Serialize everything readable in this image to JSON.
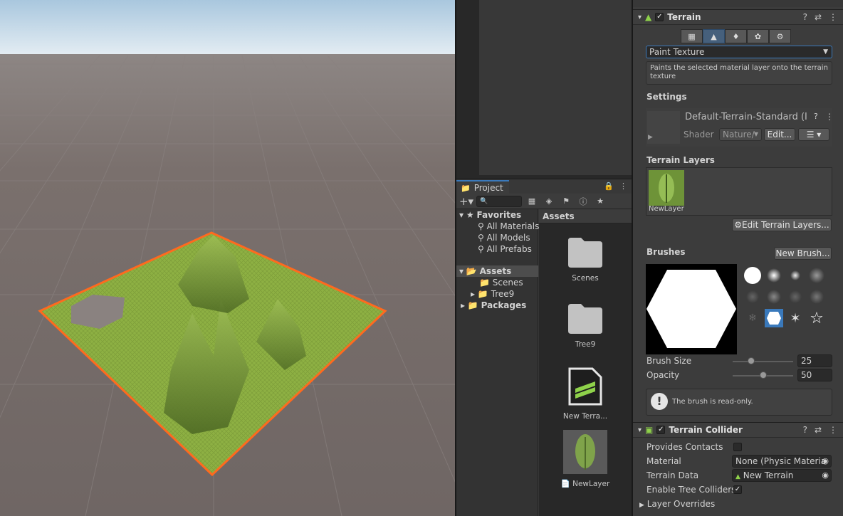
{
  "colors": {
    "sky_top": "#a9c7de",
    "sky_horizon": "#e4edf3",
    "ground": "#766d6a",
    "terrain_green": "#8db043",
    "selection_outline": "#ff6a1e",
    "accent_blue": "#3a79bb"
  },
  "project": {
    "tab_label": "Project",
    "search_placeholder": "",
    "tree": {
      "favorites": "Favorites",
      "all_materials": "All Materials",
      "all_models": "All Models",
      "all_prefabs": "All Prefabs",
      "assets": "Assets",
      "scenes": "Scenes",
      "tree9": "Tree9",
      "packages": "Packages"
    },
    "assets_header": "Assets",
    "items": [
      {
        "label": "Scenes",
        "icon": "folder-icon"
      },
      {
        "label": "Tree9",
        "icon": "folder-icon"
      },
      {
        "label": "New Terra...",
        "icon": "terrain-data-icon"
      },
      {
        "label": "NewLayer",
        "icon": "terrain-layer-icon"
      }
    ]
  },
  "inspector": {
    "terrain": {
      "title": "Terrain",
      "enabled": true,
      "tools": [
        "create-neighbor-icon",
        "paint-terrain-icon",
        "paint-trees-icon",
        "paint-details-icon",
        "terrain-settings-icon"
      ],
      "active_tool_index": 1,
      "mode_dropdown": "Paint Texture",
      "mode_description": "Paints the selected material layer onto the terrain texture",
      "settings_label": "Settings",
      "material_name": "Default-Terrain-Standard (I",
      "shader_label": "Shader",
      "shader_value": "Nature/",
      "edit_button": "Edit...",
      "terrain_layers_label": "Terrain Layers",
      "layer_name": "NewLayer",
      "edit_layers_button": "Edit Terrain Layers...",
      "brushes_label": "Brushes",
      "new_brush_button": "New Brush...",
      "selected_brush_index": 9,
      "brush_size_label": "Brush Size",
      "brush_size_value": "25",
      "brush_size_fraction": 0.3,
      "opacity_label": "Opacity",
      "opacity_value": "50",
      "opacity_fraction": 0.5,
      "readonly_message": "The brush is read-only."
    },
    "collider": {
      "title": "Terrain Collider",
      "enabled": true,
      "provides_contacts_label": "Provides Contacts",
      "provides_contacts": false,
      "material_label": "Material",
      "material_value": "None (Physic Materia",
      "terrain_data_label": "Terrain Data",
      "terrain_data_value": "New Terrain",
      "enable_tree_colliders_label": "Enable Tree Colliders",
      "enable_tree_colliders": true,
      "layer_overrides_label": "Layer Overrides"
    }
  }
}
